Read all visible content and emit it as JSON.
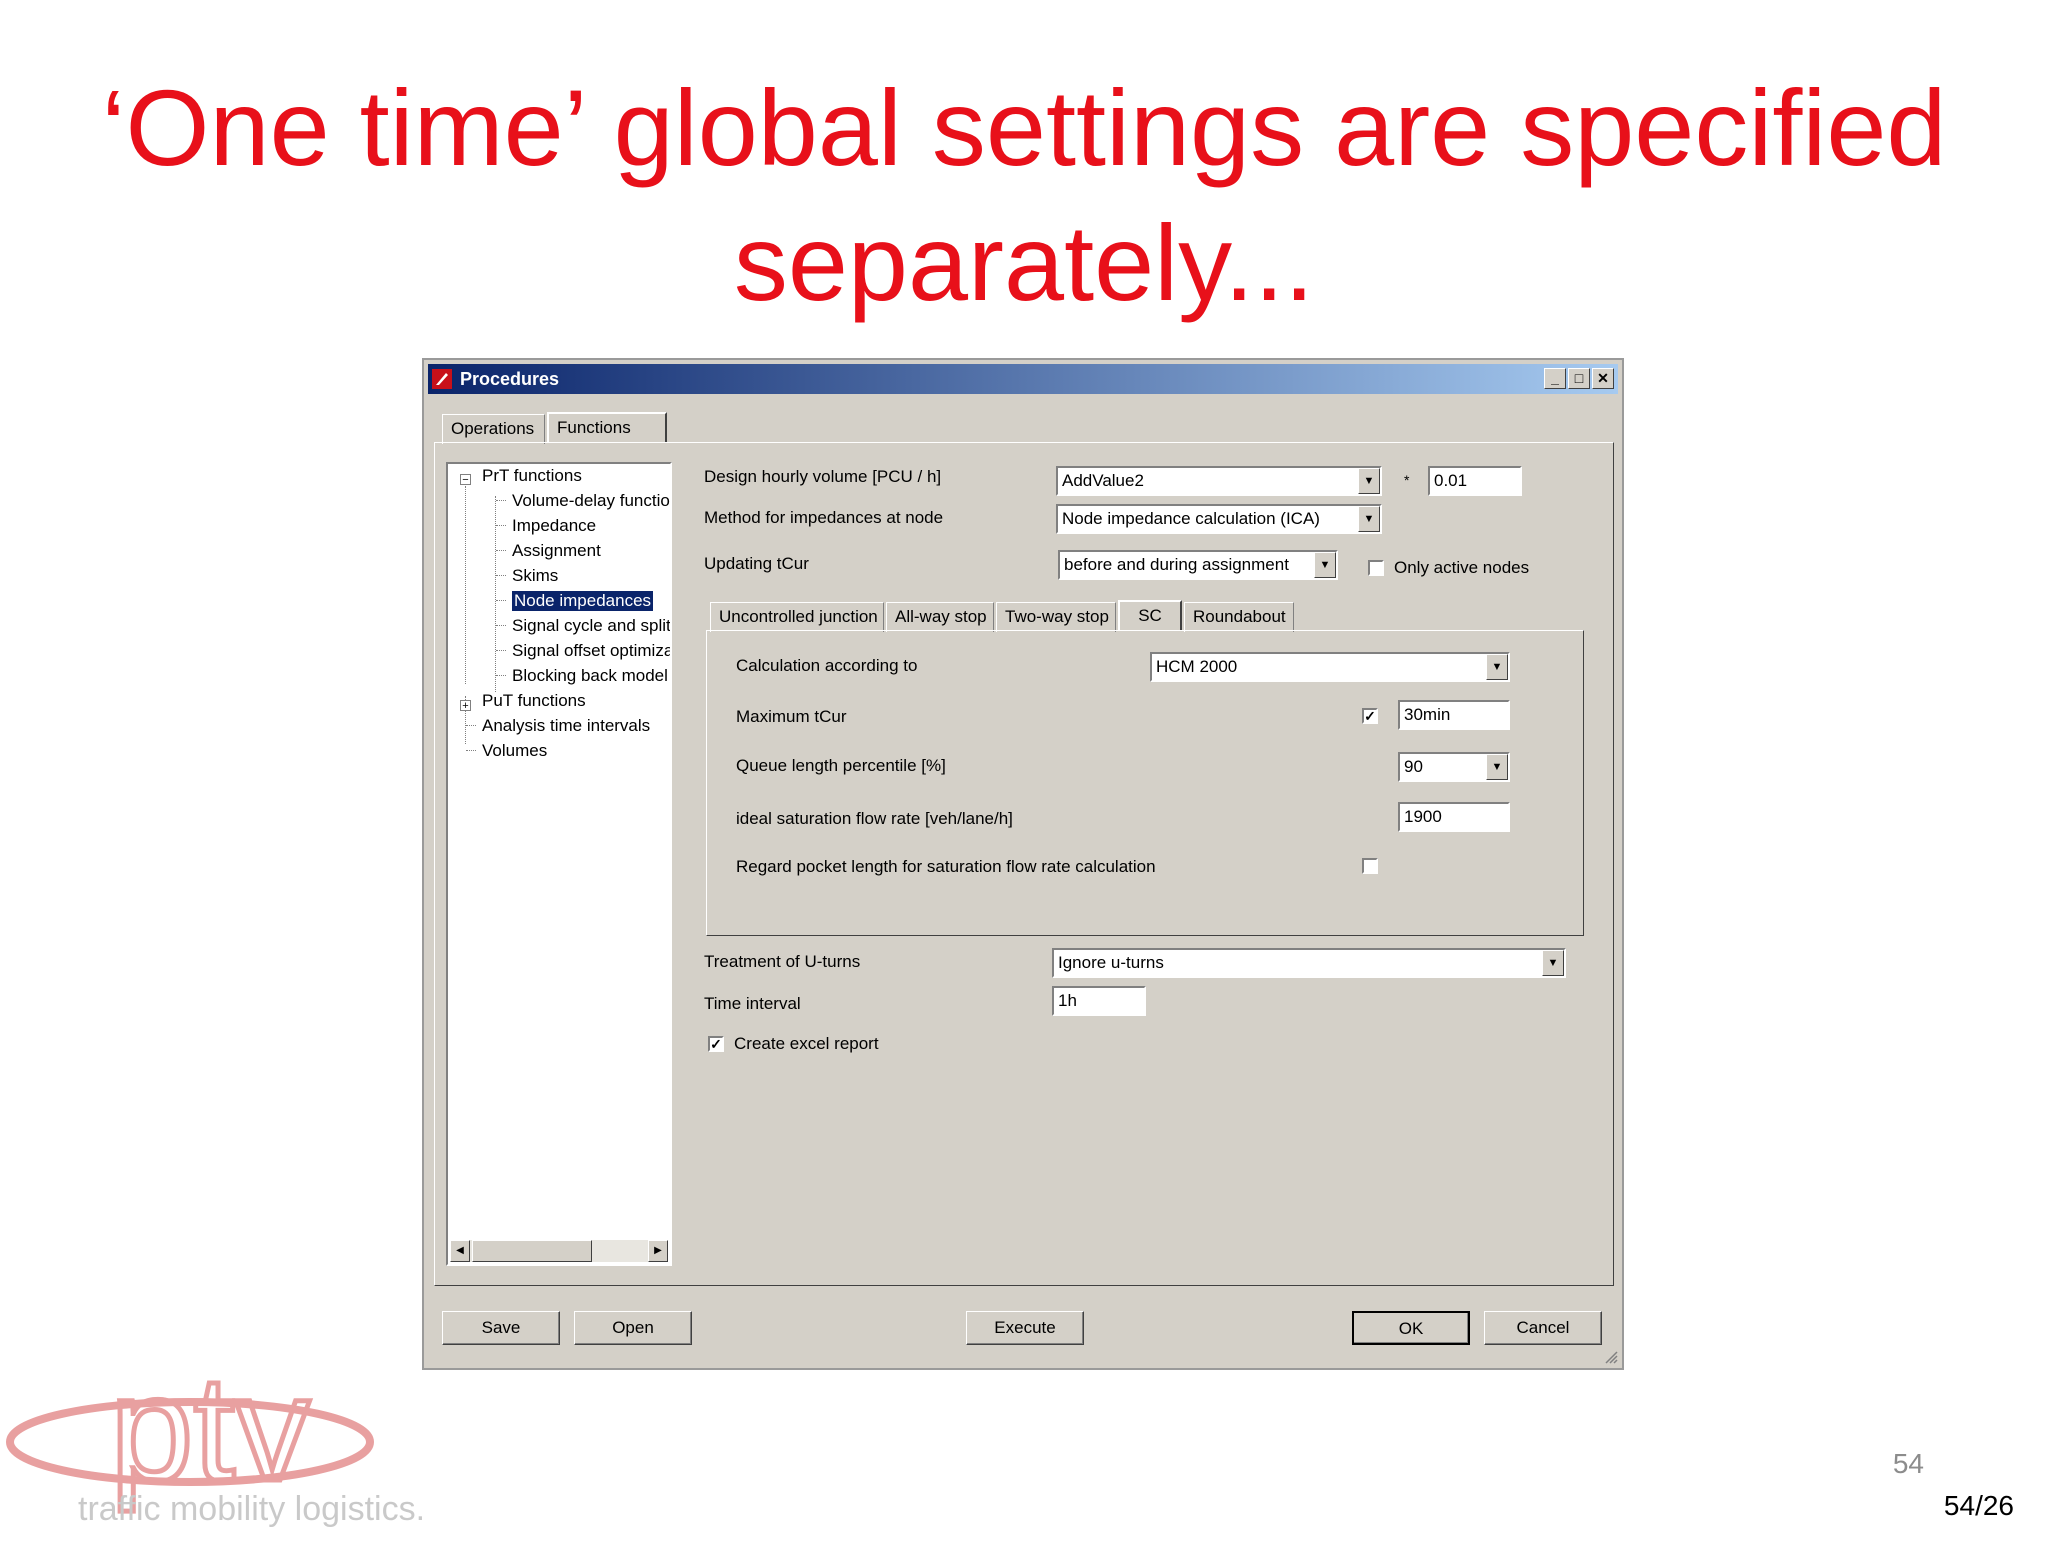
{
  "slide": {
    "title_line1": "‘One time’ global settings are specified",
    "title_line2": "separately...",
    "page_number": "54",
    "page_fraction": "54/26",
    "logo_text": "ptv",
    "logo_tagline": "traffic mobility logistics."
  },
  "window": {
    "title": "Procedures",
    "controls": {
      "minimize": "_",
      "maximize": "□",
      "close": "✕"
    },
    "tabs": [
      "Operations",
      "Functions"
    ],
    "active_tab": "Functions"
  },
  "tree": {
    "root_prt": "PrT functions",
    "prt_children": [
      "Volume-delay functio",
      "Impedance",
      "Assignment",
      "Skims",
      "Node impedances",
      "Signal cycle and split",
      "Signal offset optimiza",
      "Blocking back model"
    ],
    "root_put": "PuT functions",
    "other_items": [
      "Analysis time intervals",
      "Volumes"
    ],
    "selected": "Node impedances"
  },
  "settings": {
    "design_hourly_volume_label": "Design hourly volume [PCU / h]",
    "design_hourly_volume_value": "AddValue2",
    "multiply_sign": "*",
    "factor_value": "0.01",
    "method_label": "Method for impedances at node",
    "method_value": "Node impedance calculation (ICA)",
    "updating_label": "Updating tCur",
    "updating_value": "before and during assignment",
    "only_active_nodes_label": "Only active nodes",
    "only_active_nodes_checked": false
  },
  "subtabs": [
    "Uncontrolled junction",
    "All-way stop",
    "Two-way stop",
    "SC",
    "Roundabout"
  ],
  "active_subtab": "SC",
  "sc_panel": {
    "calc_label": "Calculation according to",
    "calc_value": "HCM 2000",
    "max_tcur_label": "Maximum tCur",
    "max_tcur_checked": true,
    "max_tcur_value": "30min",
    "queue_label": "Queue length percentile [%]",
    "queue_value": "90",
    "sat_flow_label": "ideal saturation flow rate [veh/lane/h]",
    "sat_flow_value": "1900",
    "pocket_label": "Regard pocket length for saturation flow rate calculation",
    "pocket_checked": false
  },
  "lower": {
    "uturn_label": "Treatment of U-turns",
    "uturn_value": "Ignore u-turns",
    "time_interval_label": "Time interval",
    "time_interval_value": "1h",
    "excel_label": "Create excel report",
    "excel_checked": true
  },
  "buttons": {
    "save": "Save",
    "open": "Open",
    "execute": "Execute",
    "ok": "OK",
    "cancel": "Cancel"
  },
  "icons": {
    "dropdown": "▼",
    "check": "✓",
    "scroll_left": "◀",
    "scroll_right": "▶",
    "collapse": "−",
    "expand": "+"
  },
  "colors": {
    "title_red": "#e8101a",
    "titlebar_start": "#0a246a",
    "titlebar_end": "#a6caf0",
    "dialog_bg": "#d4d0c8",
    "logo_red": "#e8a0a0"
  }
}
